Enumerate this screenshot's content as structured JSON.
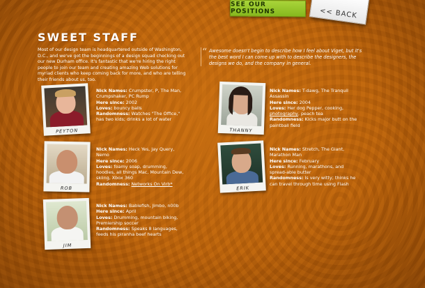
{
  "nav": {
    "positions_label": "SEE OUR POSITIONS",
    "back_label": "<< BACK"
  },
  "section": {
    "title": "SWEET STAFF",
    "intro": "Most of our design team is headquartered outside of Washington, D.C., and we've got the beginnings of a design squad checking out our new Durham office. It's fantastic that we're hiring the right people to join our team and creating amazing Web solutions for myriad clients who keep coming back for more, and who are telling their friends about us, too.",
    "quote": "Awesome doesn't begin to describe how I feel about Viget, but it's the best word I can come up with to describe the designers, the designs we do, and the company in general."
  },
  "labels": {
    "nick": "Nick Names:",
    "since": "Here since:",
    "loves": "Loves:",
    "random": "Randomness:"
  },
  "staff": [
    {
      "name": "PEYTON",
      "nick": "Crumpster, P, The Man, Crumpshaker, PC Rump",
      "since": "2002",
      "loves": "bouncy balls",
      "random": "Watches \"The Office,\" has two kids; drinks a lot of water"
    },
    {
      "name": "THANNY",
      "nick": "T-dawg, The Tranquil Assassin",
      "since": "2004",
      "loves_pre": "Her dog Pepper, cooking, ",
      "loves_link": "photography",
      "loves_post": ", peach tea",
      "random": "Kicks major butt on the paintball field"
    },
    {
      "name": "ROB",
      "nick": "Heck Yes, Jay Query, Nemo",
      "since": "2006",
      "loves": "foamy soap, drumming, hoodies, all things Mac, Mountain Dew, skiing, Xbox 360",
      "random_link": "Networks On Virb*"
    },
    {
      "name": "ERIK",
      "nick": "Stretch, The Giant, Marathon Man",
      "since": "February",
      "loves": "Running, marathons, and spread-able butter",
      "random": "Is very witty; thinks he can travel through time using Flash"
    },
    {
      "name": "JIM",
      "nick": "Bablefish, Jimbo, n00b",
      "since": "April",
      "loves": "Drumming, mountain biking, Premiership soccer",
      "random": "Speaks 8 languages, feeds his piranha beef hearts"
    }
  ],
  "colors": {
    "background": "#b85f08",
    "tab_green": "#98c72b",
    "text": "#ffffff"
  }
}
